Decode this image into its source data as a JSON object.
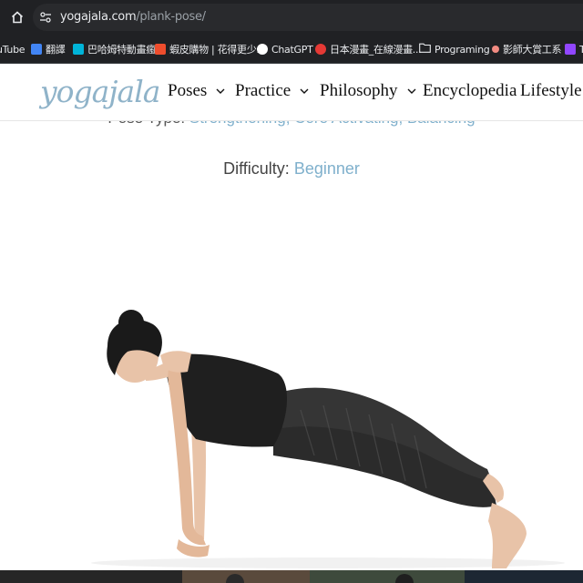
{
  "browser": {
    "url_domain": "yogajala.com",
    "url_path": "/plank-pose/",
    "bookmarks": [
      {
        "label": "uTube",
        "color": "#ff0000"
      },
      {
        "label": "翻譯",
        "color": "#4285f4"
      },
      {
        "label": "巴哈姆特動畫瘋",
        "color": "#00b4d8"
      },
      {
        "label": "蝦皮購物 | 花得更少...",
        "color": "#ee4d2d"
      },
      {
        "label": "ChatGPT",
        "color": "#ffffff"
      },
      {
        "label": "日本漫畫_在線漫畫...",
        "color": "#e53935"
      },
      {
        "label": "Programing",
        "color": "#9aa0a6"
      },
      {
        "label": "影師大賞工系",
        "color": "#f28b82"
      },
      {
        "label": "T",
        "color": "#9146ff"
      }
    ]
  },
  "site": {
    "logo": "yogajala",
    "nav": [
      {
        "label": "Poses"
      },
      {
        "label": "Practice"
      },
      {
        "label": "Philosophy"
      },
      {
        "label": "Encyclopedia"
      },
      {
        "label": "Lifestyle"
      }
    ]
  },
  "content": {
    "pose_type_label": "Pose Type:",
    "pose_type_values": "Strengthening, Core Activating, Balancing",
    "difficulty_label": "Difficulty:",
    "difficulty_value": "Beginner"
  },
  "colors": {
    "accent": "#7fb0cc",
    "logo": "#8fb3c9",
    "browser_bg": "#202124"
  }
}
